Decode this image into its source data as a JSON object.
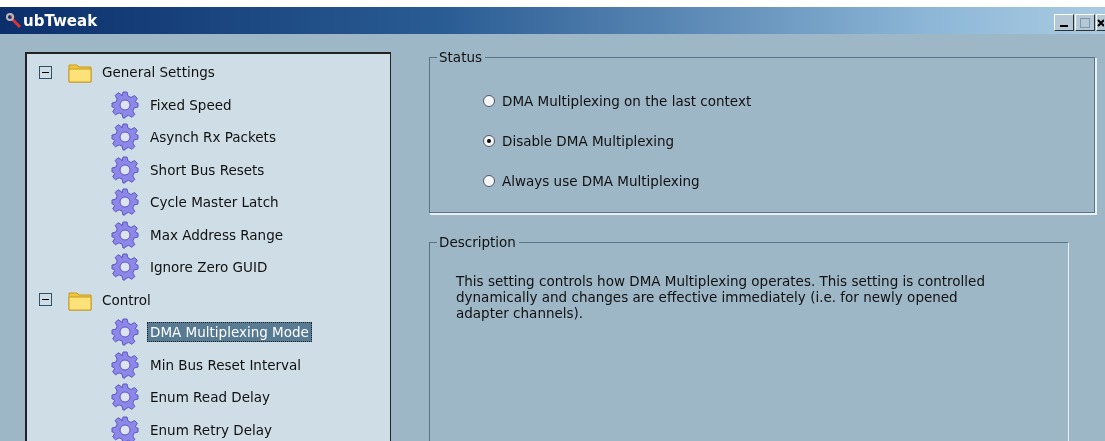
{
  "window": {
    "title": "ubTweak"
  },
  "tree": [
    {
      "label": "General Settings",
      "expanded": true,
      "children": [
        {
          "label": "Fixed Speed",
          "selected": false
        },
        {
          "label": "Asynch Rx Packets",
          "selected": false
        },
        {
          "label": "Short Bus Resets",
          "selected": false
        },
        {
          "label": "Cycle Master Latch",
          "selected": false
        },
        {
          "label": "Max Address Range",
          "selected": false
        },
        {
          "label": "Ignore Zero GUID",
          "selected": false
        }
      ]
    },
    {
      "label": "Control",
      "expanded": true,
      "children": [
        {
          "label": "DMA Multiplexing Mode",
          "selected": true
        },
        {
          "label": "Min Bus Reset Interval",
          "selected": false
        },
        {
          "label": "Enum Read Delay",
          "selected": false
        },
        {
          "label": "Enum Retry Delay",
          "selected": false
        }
      ]
    }
  ],
  "status": {
    "title": "Status",
    "options": [
      {
        "label": "DMA Multiplexing on the last context",
        "selected": false
      },
      {
        "label": "Disable DMA Multiplexing",
        "selected": true
      },
      {
        "label": "Always use DMA Multiplexing",
        "selected": false
      }
    ]
  },
  "description": {
    "title": "Description",
    "text": "This setting controls how DMA Multiplexing operates. This setting is controlled dynamically and changes are effective immediately (i.e. for newly opened adapter channels)."
  }
}
